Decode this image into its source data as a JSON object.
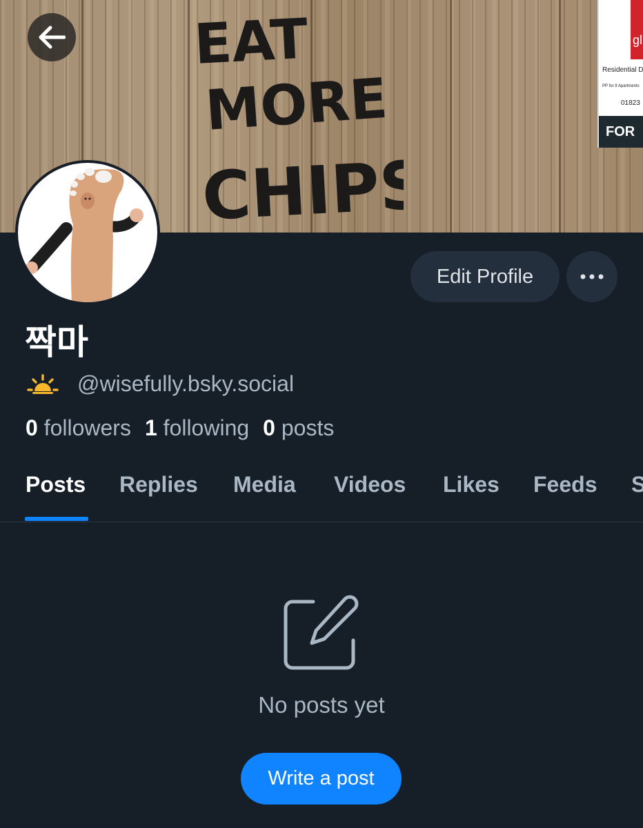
{
  "banner": {
    "graffiti_lines": [
      "EAT",
      "MORE",
      "CHIPS"
    ],
    "sign": {
      "brand": "gl",
      "title": "Residential Dev",
      "subtitle": "PP for 9 Apartments",
      "phone": "01823",
      "footer": "FOR"
    }
  },
  "profile": {
    "display_name": "짝마",
    "handle": "@wisefully.bsky.social",
    "stats": {
      "followers_count": "0",
      "followers_label": "followers",
      "following_count": "1",
      "following_label": "following",
      "posts_count": "0",
      "posts_label": "posts"
    }
  },
  "buttons": {
    "edit_profile": "Edit Profile",
    "write_post": "Write a post"
  },
  "tabs": [
    {
      "label": "Posts",
      "active": true
    },
    {
      "label": "Replies"
    },
    {
      "label": "Media"
    },
    {
      "label": "Videos"
    },
    {
      "label": "Likes"
    },
    {
      "label": "Feeds"
    },
    {
      "label": "S"
    }
  ],
  "empty_state": {
    "message": "No posts yet",
    "icon": "compose-icon"
  },
  "icons": {
    "back": "arrow-left-icon",
    "more": "ellipsis-icon",
    "handle_badge": "sunrise-icon"
  },
  "colors": {
    "background": "#161e27",
    "accent": "#1083fe",
    "pill": "#232f3d",
    "muted_text": "#aab8c6",
    "sun": "#f6b72b"
  }
}
